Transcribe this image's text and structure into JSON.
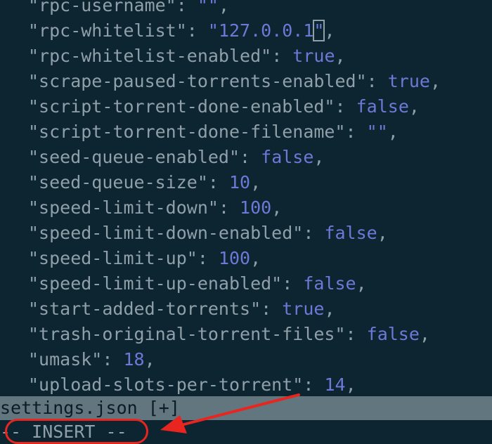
{
  "editor": {
    "lines": [
      {
        "key": "\"rpc-username\"",
        "value": "\"\"",
        "vtype": "str"
      },
      {
        "key": "\"rpc-whitelist\"",
        "value": "\"127.0.0.1\"",
        "vtype": "str",
        "cursor": true
      },
      {
        "key": "\"rpc-whitelist-enabled\"",
        "value": "true",
        "vtype": "bool"
      },
      {
        "key": "\"scrape-paused-torrents-enabled\"",
        "value": "true",
        "vtype": "bool"
      },
      {
        "key": "\"script-torrent-done-enabled\"",
        "value": "false",
        "vtype": "bool"
      },
      {
        "key": "\"script-torrent-done-filename\"",
        "value": "\"\"",
        "vtype": "str"
      },
      {
        "key": "\"seed-queue-enabled\"",
        "value": "false",
        "vtype": "bool"
      },
      {
        "key": "\"seed-queue-size\"",
        "value": "10",
        "vtype": "num"
      },
      {
        "key": "\"speed-limit-down\"",
        "value": "100",
        "vtype": "num"
      },
      {
        "key": "\"speed-limit-down-enabled\"",
        "value": "false",
        "vtype": "bool"
      },
      {
        "key": "\"speed-limit-up\"",
        "value": "100",
        "vtype": "num"
      },
      {
        "key": "\"speed-limit-up-enabled\"",
        "value": "false",
        "vtype": "bool"
      },
      {
        "key": "\"start-added-torrents\"",
        "value": "true",
        "vtype": "bool"
      },
      {
        "key": "\"trash-original-torrent-files\"",
        "value": "false",
        "vtype": "bool"
      },
      {
        "key": "\"umask\"",
        "value": "18",
        "vtype": "num"
      },
      {
        "key": "\"upload-slots-per-torrent\"",
        "value": "14",
        "vtype": "num"
      }
    ],
    "separator": ": ",
    "trailing": ","
  },
  "statusbar": {
    "filename": "settings.json",
    "modified": "[+]"
  },
  "modeline": {
    "text": "-- INSERT --"
  },
  "colors": {
    "background": "#0d2431",
    "key": "#8fa0a9",
    "value": "#6b7ad6",
    "statusbar": "#61767e",
    "annotation": "#e8261f"
  },
  "icons": [
    "arrow-annotation-icon"
  ]
}
